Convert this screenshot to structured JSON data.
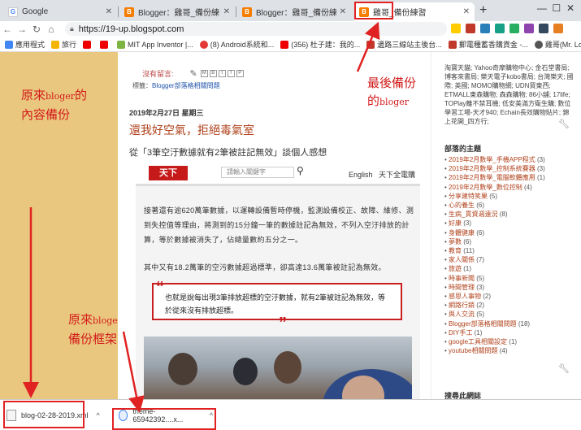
{
  "browser": {
    "tabs": [
      {
        "title": "Google",
        "favicon": "google-icon",
        "active": false
      },
      {
        "title": "Blogger：雞哥_備份練習 - 主題",
        "favicon": "blogger-icon",
        "active": false
      },
      {
        "title": "Blogger：雞哥_備份練習 - 主題",
        "favicon": "blogger-icon",
        "active": false
      },
      {
        "title": "雞哥_備份練習",
        "favicon": "blogger-icon",
        "active": true
      }
    ],
    "new_tab": "+",
    "url": "https://19-up.blogspot.com",
    "bookmarks": [
      "應用程式",
      "旅行",
      "MIT App Inventor |...",
      "(8) Android系統和...",
      "(356) 杜子建：我的...",
      "邊路三線站主後台...",
      "郵電種蓄香購貨金 -...",
      "雞哥(Mr. Logic)"
    ]
  },
  "annotations": {
    "left_top": [
      "原來",
      "bloger",
      "的",
      "內容備份"
    ],
    "left_bottom": [
      "原來",
      "bloger",
      "的",
      "備份框架"
    ],
    "right_top": [
      "最後備份",
      "的",
      "bloger"
    ],
    "colors": {
      "annotation": "#d21b1b",
      "box": "#e02222"
    }
  },
  "post": {
    "comment_label": "沒有留言:",
    "share_buttons": [
      "M",
      "B",
      "t",
      "f",
      "P"
    ],
    "labels_prefix": "標籤：",
    "labels_link": "Blogger部落格相關問題",
    "date": "2019年2月27日 星期三",
    "title": "還我好空氣，拒絕毒氣室",
    "subtitle": "從「3筆空汙數據就有2筆被註記無效」談個人感想"
  },
  "article": {
    "logo": "天下",
    "search_placeholder": "請輸入關鍵字",
    "nav_items": [
      "English",
      "天下全電購",
      "會"
    ],
    "para1": "接著還有逾620萬筆數據，以運轉設備暫時停機，監測設備校正、故障、維修、測到失控值等理由，將測到的15分鐘一筆的數據註記為無效，不列入空汙排放的計算，等於數據被消失了，佔總量數約五分之一。",
    "para2": "其中又有18.2萬筆的空污數據超過標準，卻高達13.6萬筆被註記為無效。",
    "quote": "也就是說每出現3筆排放超標的空汙數據，就有2筆被註記為無效，等於從來沒有排放超標。"
  },
  "sidebar": {
    "links_text": "淘寶天貓; Yahoo奇摩購物中心; 金石堂書局; 博客來書局; 樂天電子kobo書局; 台灣樂天; 國際; 英國; MOMO購物網; UDN買東西; ETMALL東森購物; 森森購物; 86小舖; 17life; TOPlay離不禁耳機; 低安美滿方衛生購; 數位學習工場-天才940; Echain長效購物貼片; 錦上花開_四方行;",
    "labels_title": "部落的主題",
    "labels": [
      {
        "name": "2019年2月數學_手機APP程式",
        "count": "(3)"
      },
      {
        "name": "2019年2月數學_控制系統賽器",
        "count": "(3)"
      },
      {
        "name": "2019年2月數學_電腦軟體應用",
        "count": "(1)"
      },
      {
        "name": "2019年2月數學_數位控制",
        "count": "(4)"
      },
      {
        "name": "分享建特笑果",
        "count": "(5)"
      },
      {
        "name": "心的養生",
        "count": "(6)"
      },
      {
        "name": "生病_貫資週遠況",
        "count": "(8)"
      },
      {
        "name": "好康",
        "count": "(3)"
      },
      {
        "name": "身體健康",
        "count": "(6)"
      },
      {
        "name": "夢數",
        "count": "(6)"
      },
      {
        "name": "教育",
        "count": "(11)"
      },
      {
        "name": "家人關係",
        "count": "(7)"
      },
      {
        "name": "旅遊",
        "count": "(1)"
      },
      {
        "name": "時事新聞",
        "count": "(5)"
      },
      {
        "name": "時間管理",
        "count": "(3)"
      },
      {
        "name": "感恩人事物",
        "count": "(2)"
      },
      {
        "name": "網路行銷",
        "count": "(2)"
      },
      {
        "name": "與人交流",
        "count": "(5)"
      },
      {
        "name": "Blogger部落格相關問題",
        "count": "(18)"
      },
      {
        "name": "DIY手工",
        "count": "(1)"
      },
      {
        "name": "google工具相關設定",
        "count": "(1)"
      },
      {
        "name": "youtube相關問題",
        "count": "(4)"
      }
    ],
    "search_title": "搜尋此網誌"
  },
  "downloads": [
    {
      "filename": "blog-02-28-2019.xml",
      "chevron": "^"
    },
    {
      "filename": "theme-65942392....x...",
      "chevron": "^"
    }
  ]
}
